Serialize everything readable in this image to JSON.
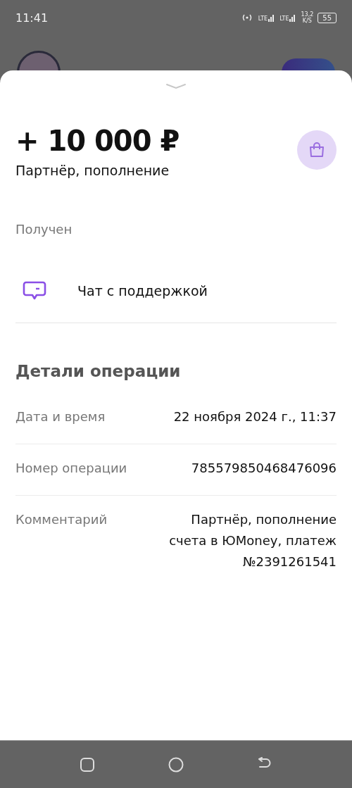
{
  "status_bar": {
    "time": "11:41",
    "networks": [
      "LTE",
      "LTE"
    ],
    "speed_value": "13,2",
    "speed_unit": "K/S",
    "battery": "55"
  },
  "header": {
    "amount": "+ 10 000 ₽",
    "subtitle": "Партнёр, пополнение"
  },
  "status": "Получен",
  "support": {
    "label": "Чат с поддержкой"
  },
  "details": {
    "title": "Детали операции",
    "rows": [
      {
        "label": "Дата и время",
        "value": "22 ноября 2024 г., 11:37"
      },
      {
        "label": "Номер операции",
        "value": "785579850468476096"
      },
      {
        "label": "Комментарий",
        "value": "Партнёр, пополнение счета в ЮMoney, платеж №2391261541"
      }
    ]
  }
}
